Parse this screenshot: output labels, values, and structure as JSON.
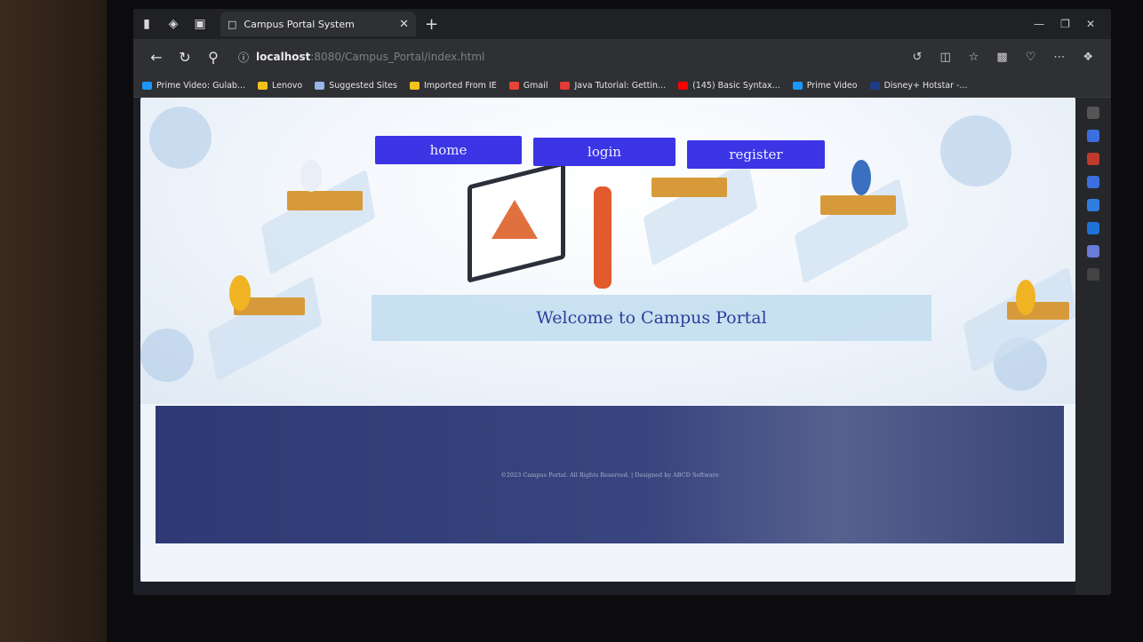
{
  "browser": {
    "tab_title": "Campus Portal System",
    "url_host": "localhost",
    "url_path": ":8080/Campus_Portal/index.html",
    "bookmarks": [
      {
        "label": "Prime Video: Gulab...",
        "color": "#1a98ff"
      },
      {
        "label": "Lenovo",
        "color": "#f2c21b"
      },
      {
        "label": "Suggested Sites",
        "color": "#9ab4e8"
      },
      {
        "label": "Imported From IE",
        "color": "#f2c21b"
      },
      {
        "label": "Gmail",
        "color": "#ea4335"
      },
      {
        "label": "Java Tutorial: Gettin...",
        "color": "#e53935"
      },
      {
        "label": "(145) Basic Syntax...",
        "color": "#ff0000"
      },
      {
        "label": "Prime Video",
        "color": "#1a98ff"
      },
      {
        "label": "Disney+ Hotstar -...",
        "color": "#1f3c88"
      }
    ]
  },
  "page": {
    "nav": {
      "home": "home",
      "login": "login",
      "register": "register"
    },
    "welcome": "Welcome to Campus Portal",
    "footer": "©2023 Campus Portal. All Rights Reserved. | Designed by ABCD Software"
  },
  "colors": {
    "nav_button": "#3b35e5",
    "welcome_text": "#2b3f9a",
    "footer_bg": "#2f3a74"
  }
}
